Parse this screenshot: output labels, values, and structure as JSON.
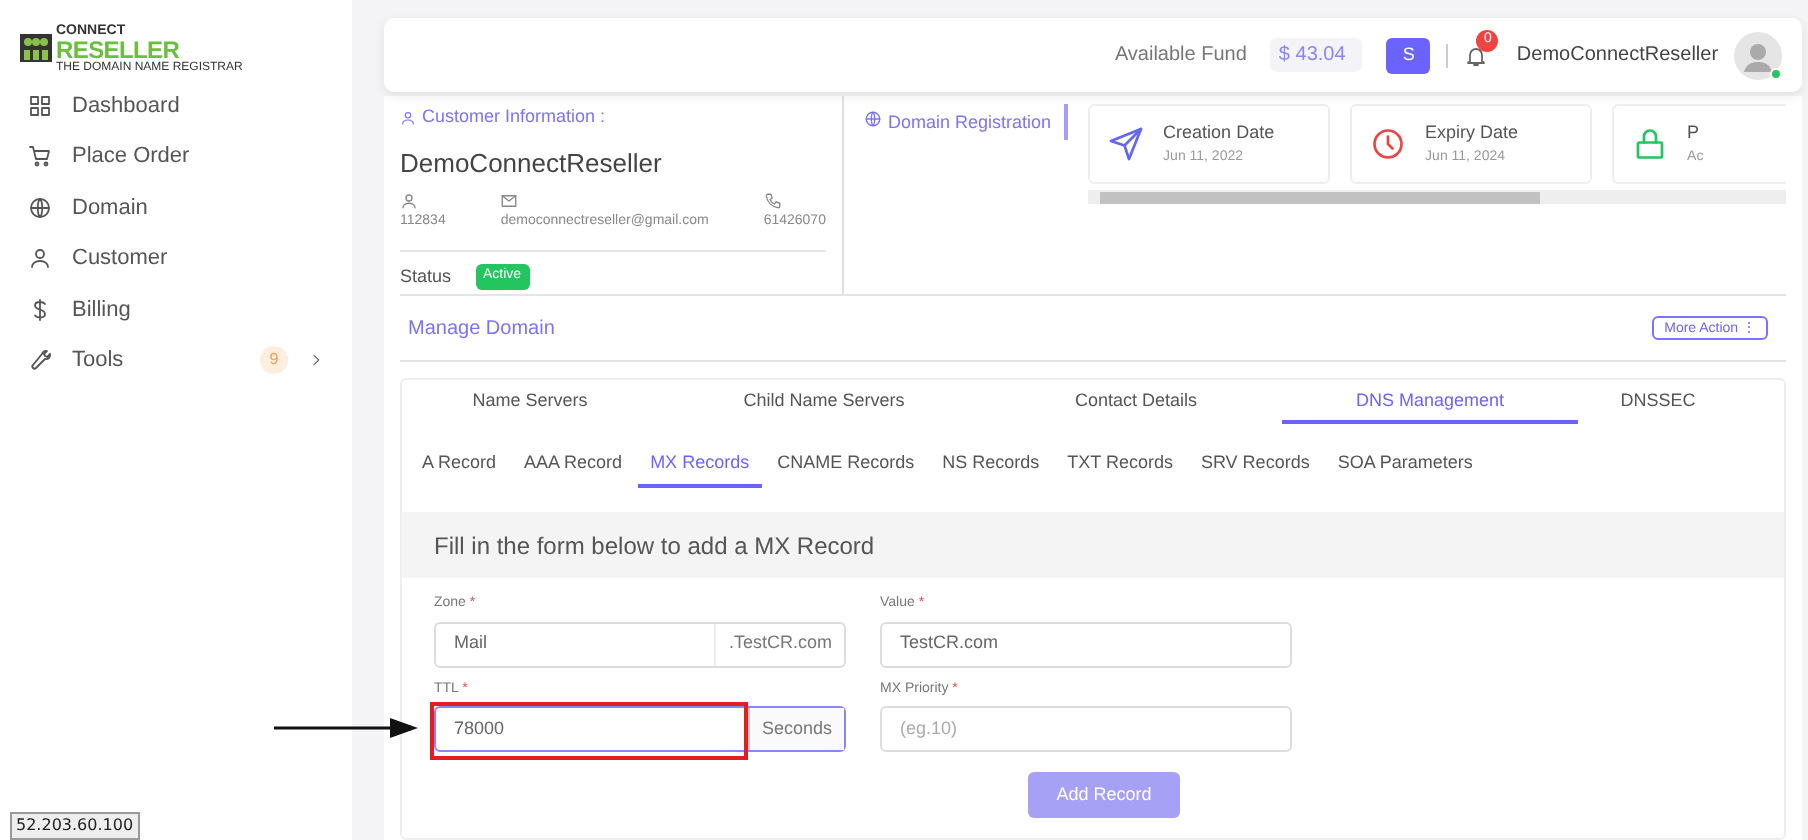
{
  "sidebar": {
    "logo": {
      "top": "CONNECT",
      "main": "RESELLER",
      "tagline": "THE DOMAIN NAME REGISTRAR"
    },
    "items": [
      {
        "label": "Dashboard",
        "selected": false
      },
      {
        "label": "Place Order",
        "selected": false
      },
      {
        "label": "Domain",
        "selected": false
      },
      {
        "label": "Customer",
        "selected": false
      },
      {
        "label": "Billing",
        "selected": false
      },
      {
        "label": "Tools",
        "selected": false,
        "badge": "9",
        "expandable": true
      }
    ]
  },
  "header": {
    "fund_label": "Available Fund",
    "fund_value": "$ 43.04",
    "currency_button": "S",
    "notification_count": "0",
    "user_name": "DemoConnectReseller",
    "online": true
  },
  "customer": {
    "heading": "Customer Information :",
    "name": "DemoConnectReseller",
    "id": "112834",
    "email": "democonnectreseller@gmail.com",
    "phone": "61426070",
    "status_label": "Status",
    "status": "Active"
  },
  "domain_registration": {
    "label": "Domain Registration",
    "selected": true
  },
  "stats": [
    {
      "title": "Creation Date",
      "value": "Jun 11, 2022",
      "color": "#6366f1"
    },
    {
      "title": "Expiry Date",
      "value": "Jun 11, 2024",
      "color": "#ef4444"
    },
    {
      "title": "P",
      "value": "Ac",
      "color": "#22c55e"
    }
  ],
  "manage": {
    "title": "Manage Domain",
    "more_action": "More Action ⋮"
  },
  "tabs": [
    {
      "label": "Name Servers",
      "selected": false
    },
    {
      "label": "Child Name Servers",
      "selected": false
    },
    {
      "label": "Contact Details",
      "selected": false
    },
    {
      "label": "DNS Management",
      "selected": true
    },
    {
      "label": "DNSSEC",
      "selected": false
    }
  ],
  "record_tabs": [
    {
      "label": "A Record",
      "selected": false
    },
    {
      "label": "AAA Record",
      "selected": false
    },
    {
      "label": "MX Records",
      "selected": true
    },
    {
      "label": "CNAME Records",
      "selected": false
    },
    {
      "label": "NS Records",
      "selected": false
    },
    {
      "label": "TXT Records",
      "selected": false
    },
    {
      "label": "SRV Records",
      "selected": false
    },
    {
      "label": "SOA Parameters",
      "selected": false
    }
  ],
  "form": {
    "title": "Fill in the form below to add a MX Record",
    "fields": [
      {
        "label": "Zone",
        "required_mark": "*",
        "value": "Mail",
        "suffix": ".TestCR.com",
        "focused": false
      },
      {
        "label": "Value",
        "required_mark": "*",
        "value": "TestCR.com",
        "focused": false
      },
      {
        "label": "TTL",
        "required_mark": "*",
        "value": "78000",
        "suffix": "Seconds",
        "focused": true,
        "highlighted": true
      },
      {
        "label": "MX Priority",
        "required_mark": "*",
        "placeholder": "(eg.10)",
        "focused": false
      }
    ],
    "submit": {
      "label": "Add Record",
      "disabled": true
    }
  },
  "ip_label": "52.203.60.100"
}
